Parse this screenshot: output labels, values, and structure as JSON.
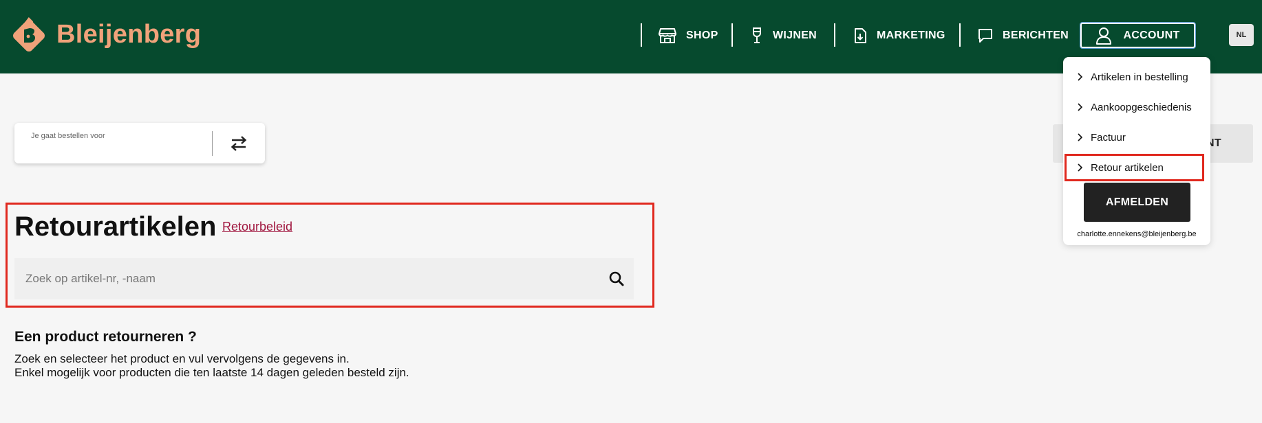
{
  "brand": {
    "name": "Bleijenberg",
    "accent": "#f0a27a",
    "header_bg": "#064a2e"
  },
  "nav": {
    "shop": "SHOP",
    "wijnen": "WIJNEN",
    "marketing": "MARKETING",
    "berichten": "BERICHTEN",
    "account": "ACCOUNT",
    "lang": "NL"
  },
  "order_for": {
    "label": "Je gaat bestellen voor",
    "icon": "swap-icon"
  },
  "client_button": {
    "label_visible": "ENT"
  },
  "returns": {
    "title": "Retourartikelen",
    "policy_link": "Retourbeleid",
    "search_placeholder": "Zoek op artikel-nr, -naam",
    "howto_title": "Een product retourneren ?",
    "howto_line1": "Zoek en selecteer het product en vul vervolgens de gegevens in.",
    "howto_line2": "Enkel mogelijk voor producten die ten laatste 14 dagen geleden besteld zijn."
  },
  "account_menu": {
    "items": [
      {
        "label": "Artikelen in bestelling"
      },
      {
        "label": "Aankoopgeschiedenis"
      },
      {
        "label": "Factuur"
      },
      {
        "label": "Retour artikelen"
      }
    ],
    "logout": "AFMELDEN",
    "email": "charlotte.ennekens@bleijenberg.be"
  },
  "highlight_color": "#e0281e"
}
